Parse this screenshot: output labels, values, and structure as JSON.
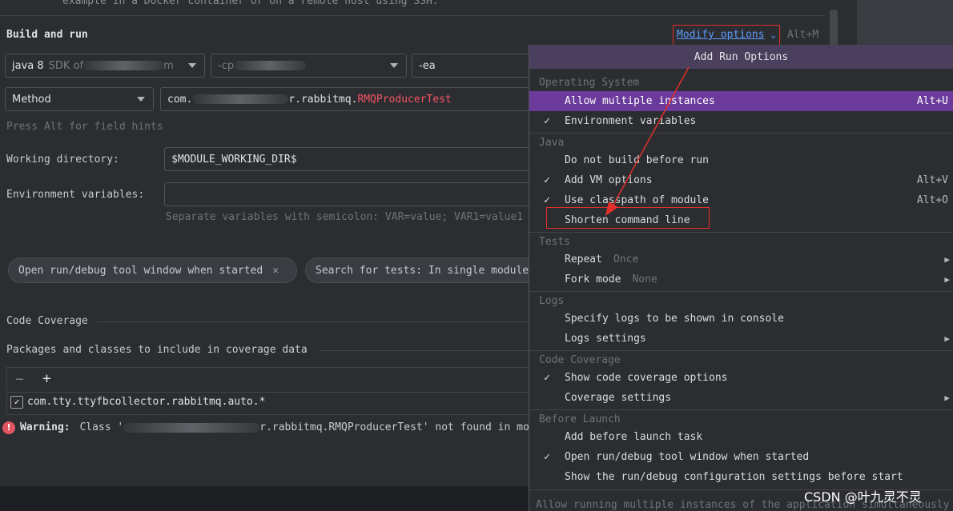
{
  "top_note": "example in a Docker container or on a remote host using SSH.",
  "section": {
    "title": "Build and run"
  },
  "modify_options": {
    "label": "Modify options",
    "shortcut": "Alt+M"
  },
  "sdk": {
    "label": "java 8",
    "detail": "SDK of ",
    "detail_tail": "m"
  },
  "cp": {
    "label": "-cp "
  },
  "vm_opts": {
    "value": "-ea"
  },
  "test_kind": {
    "value": "Method"
  },
  "class_field": {
    "prefix": "com.",
    "mid": "r.rabbitmq.",
    "highlight": "RMQProducerTest"
  },
  "field_hint": "Press Alt for field hints",
  "working_dir": {
    "label": "Working directory:",
    "value": "$MODULE_WORKING_DIR$"
  },
  "env": {
    "label": "Environment variables:",
    "hint": "Separate variables with semicolon: VAR=value; VAR1=value1"
  },
  "chips": {
    "open_tool": "Open run/debug tool window when started",
    "search_tests": "Search for tests: In single module"
  },
  "coverage": {
    "title": "Code Coverage",
    "packages_label": "Packages and classes to include in coverage data",
    "entry": "com.tty.ttyfbcollector.rabbitmq.auto.*"
  },
  "warning": {
    "bold": "Warning:",
    "text_a": "Class '",
    "text_b": "r.rabbitmq.RMQProducerTest' not found in mo"
  },
  "popup": {
    "title": "Add Run Options",
    "groups": {
      "os": "Operating System",
      "java": "Java",
      "tests": "Tests",
      "logs": "Logs",
      "coverage": "Code Coverage",
      "before": "Before Launch"
    },
    "items": {
      "allow_multiple": {
        "label": "Allow multiple instances",
        "shortcut": "Alt+U"
      },
      "env_vars": {
        "label": "Environment variables",
        "check": "✓"
      },
      "no_build": {
        "label": "Do not build before run"
      },
      "add_vm": {
        "label": "Add VM options",
        "shortcut": "Alt+V",
        "check": "✓"
      },
      "use_classpath": {
        "label": "Use classpath of module",
        "shortcut": "Alt+O",
        "check": "✓"
      },
      "shorten": {
        "label": "Shorten command line"
      },
      "repeat": {
        "label": "Repeat",
        "sub": "Once"
      },
      "fork": {
        "label": "Fork mode",
        "sub": "None"
      },
      "logs_console": {
        "label": "Specify logs to be shown in console"
      },
      "logs_settings": {
        "label": "Logs settings"
      },
      "show_coverage": {
        "label": "Show code coverage options",
        "check": "✓"
      },
      "coverage_settings": {
        "label": "Coverage settings"
      },
      "add_before": {
        "label": "Add before launch task"
      },
      "open_tool_window": {
        "label": "Open run/debug tool window when started",
        "check": "✓"
      },
      "show_config": {
        "label": "Show the run/debug configuration settings before start"
      }
    },
    "footer": "Allow running multiple instances of the application simultaneously"
  },
  "watermark": "CSDN @叶九灵不灵",
  "colors": {
    "accent_selected": "#6b3a9a",
    "link": "#5f9bff",
    "annotation": "#e0302a",
    "error": "#e05561"
  }
}
